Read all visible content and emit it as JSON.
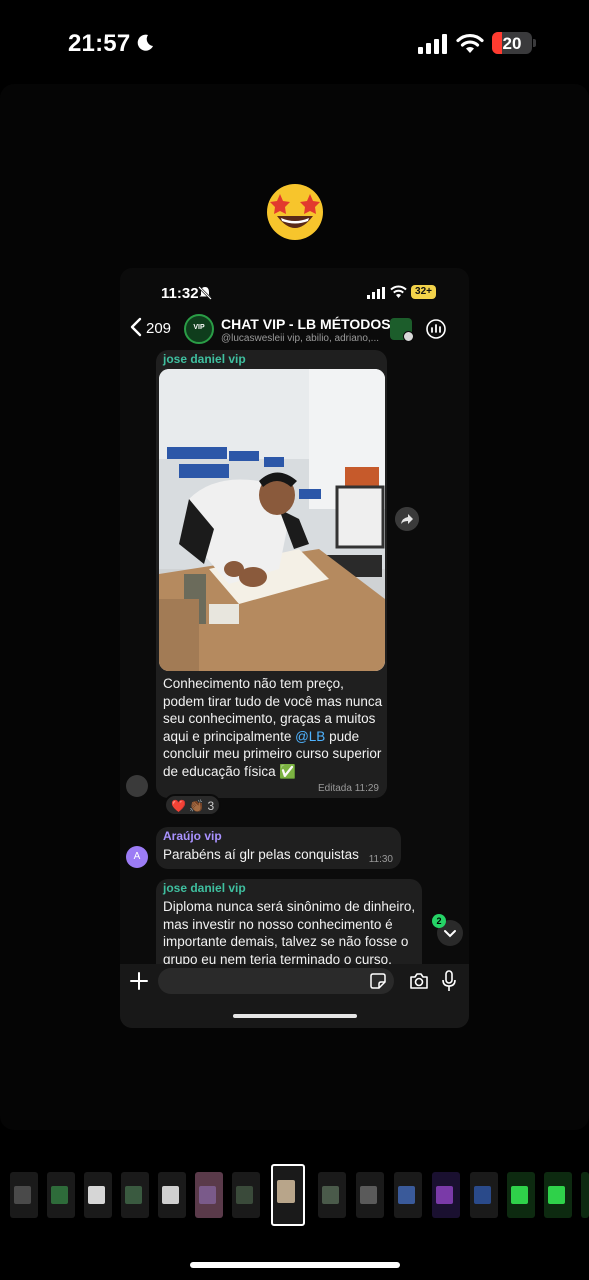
{
  "os_status": {
    "time": "21:57",
    "battery": "20"
  },
  "inner": {
    "status": {
      "time": "11:32",
      "battery": "32+"
    },
    "header": {
      "back_count": "209",
      "group_name": "CHAT VIP - LB MÉTODOS",
      "members": "@lucaswesleii vip, abilio, adriano,..."
    },
    "messages": [
      {
        "sender": "jose daniel vip",
        "sender_color": "#3fbf9f",
        "text_parts": {
          "before": "Conhecimento não tem preço, podem tirar tudo de você mas nunca seu conhecimento, graças a muitos aqui e principalmente ",
          "mention": "@LB",
          "after": " pude concluir meu primeiro curso superior de educação física ✅"
        },
        "meta": "Editada 11:29",
        "reactions": "❤️ 👏🏾 3"
      },
      {
        "sender": "Araújo vip",
        "sender_color": "#a992ff",
        "avatar_letter": "A",
        "text": "Parabéns aí glr pelas conquistas",
        "meta": "11:30"
      },
      {
        "sender": "jose daniel vip",
        "sender_color": "#3fbf9f",
        "text": "Diploma nunca será sinônimo de dinheiro, mas investir no nosso conhecimento é importante demais, talvez se não fosse o grupo eu nem teria terminado o curso,"
      }
    ],
    "unread_count": "2"
  },
  "icons": {
    "moon": "moon-icon",
    "signal": "signal-icon",
    "wifi": "wifi-icon",
    "emoji": "star-struck-emoji",
    "share": "share-icon",
    "poll": "poll-icon",
    "plus": "plus-icon",
    "sticker": "sticker-icon",
    "camera": "camera-icon",
    "mic": "mic-icon"
  }
}
